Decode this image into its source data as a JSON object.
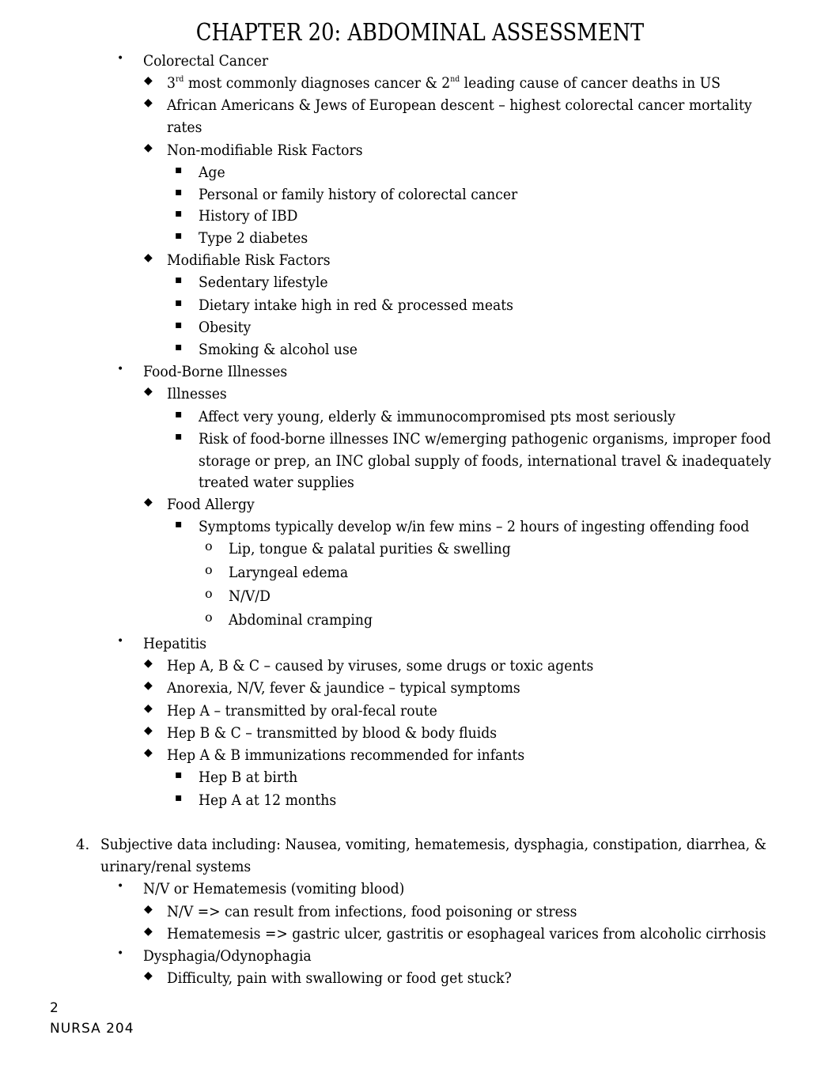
{
  "title": "CHAPTER 20: ABDOMINAL ASSESSMENT",
  "lines": [
    {
      "level": 1,
      "marker": "•",
      "text": "Colorectal Cancer"
    },
    {
      "level": 2,
      "marker": "◆",
      "text": "3rd most commonly diagnoses cancer & 2nd leading cause of cancer deaths in US",
      "sup": true
    },
    {
      "level": 2,
      "marker": "◆",
      "text": "African Americans & Jews of European descent – highest colorectal cancer mortality"
    },
    {
      "level": 2,
      "marker": "",
      "text": "rates"
    },
    {
      "level": 2,
      "marker": "◆",
      "text": "Non-modifiable Risk Factors"
    },
    {
      "level": 3,
      "marker": "▪",
      "text": "Age"
    },
    {
      "level": 3,
      "marker": "▪",
      "text": "Personal or family history of colorectal cancer"
    },
    {
      "level": 3,
      "marker": "▪",
      "text": "History of IBD"
    },
    {
      "level": 3,
      "marker": "▪",
      "text": "Type 2 diabetes"
    },
    {
      "level": 2,
      "marker": "◆",
      "text": "Modifiable Risk Factors"
    },
    {
      "level": 3,
      "marker": "▪",
      "text": "Sedentary lifestyle"
    },
    {
      "level": 3,
      "marker": "▪",
      "text": "Dietary intake high in red & processed meats"
    },
    {
      "level": 3,
      "marker": "▪",
      "text": "Obesity"
    },
    {
      "level": 3,
      "marker": "▪",
      "text": "Smoking & alcohol use"
    },
    {
      "level": 1,
      "marker": "•",
      "text": "Food-Borne Illnesses"
    },
    {
      "level": 2,
      "marker": "◆",
      "text": "Illnesses"
    },
    {
      "level": 3,
      "marker": "▪",
      "text": "Affect very young, elderly & immunocompromised pts most seriously"
    },
    {
      "level": 3,
      "marker": "▪",
      "text": "Risk of food-borne illnesses INC w/emerging pathogenic organisms, improper food"
    },
    {
      "level": 3,
      "marker": "",
      "text": "storage or prep, an INC global supply of foods, international travel & inadequately"
    },
    {
      "level": 3,
      "marker": "",
      "text": "treated water supplies"
    },
    {
      "level": 2,
      "marker": "◆",
      "text": "Food Allergy"
    },
    {
      "level": 3,
      "marker": "▪",
      "text": "Symptoms typically develop w/in few mins – 2 hours of ingesting offending food"
    },
    {
      "level": 4,
      "marker": "o",
      "text": "Lip, tongue & palatal purities & swelling"
    },
    {
      "level": 4,
      "marker": "o",
      "text": "Laryngeal edema"
    },
    {
      "level": 4,
      "marker": "o",
      "text": "N/V/D"
    },
    {
      "level": 4,
      "marker": "o",
      "text": "Abdominal cramping"
    },
    {
      "level": 1,
      "marker": "•",
      "text": "Hepatitis"
    },
    {
      "level": 2,
      "marker": "◆",
      "text": "Hep A, B & C – caused by viruses, some drugs or toxic agents"
    },
    {
      "level": 2,
      "marker": "◆",
      "text": "Anorexia, N/V, fever & jaundice – typical symptoms"
    },
    {
      "level": 2,
      "marker": "◆",
      "text": "Hep A – transmitted by oral-fecal route"
    },
    {
      "level": 2,
      "marker": "◆",
      "text": "Hep B & C – transmitted by blood & body fluids"
    },
    {
      "level": 2,
      "marker": "◆",
      "text": "Hep A & B immunizations recommended for infants"
    },
    {
      "level": 3,
      "marker": "▪",
      "text": "Hep B at birth"
    },
    {
      "level": 3,
      "marker": "▪",
      "text": "Hep A at 12 months"
    },
    {
      "level": 0,
      "marker": "4.",
      "text": "Subjective data including: Nausea, vomiting, hematemesis, dysphagia, constipation, diarrhea, &"
    },
    {
      "level": 0,
      "marker": "",
      "text": "urinary/renal systems"
    },
    {
      "level": 1,
      "marker": "•",
      "text": "N/V or Hematemesis (vomiting blood)"
    },
    {
      "level": 2,
      "marker": "◆",
      "text": "N/V => can result from infections, food poisoning or stress"
    },
    {
      "level": 2,
      "marker": "◆",
      "text": "Hematemesis => gastric ulcer, gastritis or esophageal varices from alcoholic cirrhosis"
    },
    {
      "level": 1,
      "marker": "•",
      "text": "Dysphagia/Odynophagia"
    },
    {
      "level": 2,
      "marker": "◆",
      "text": "Difficulty, pain with swallowing or food get stuck?"
    }
  ],
  "footer": {
    "page": "2",
    "course": "NURSA 204"
  }
}
